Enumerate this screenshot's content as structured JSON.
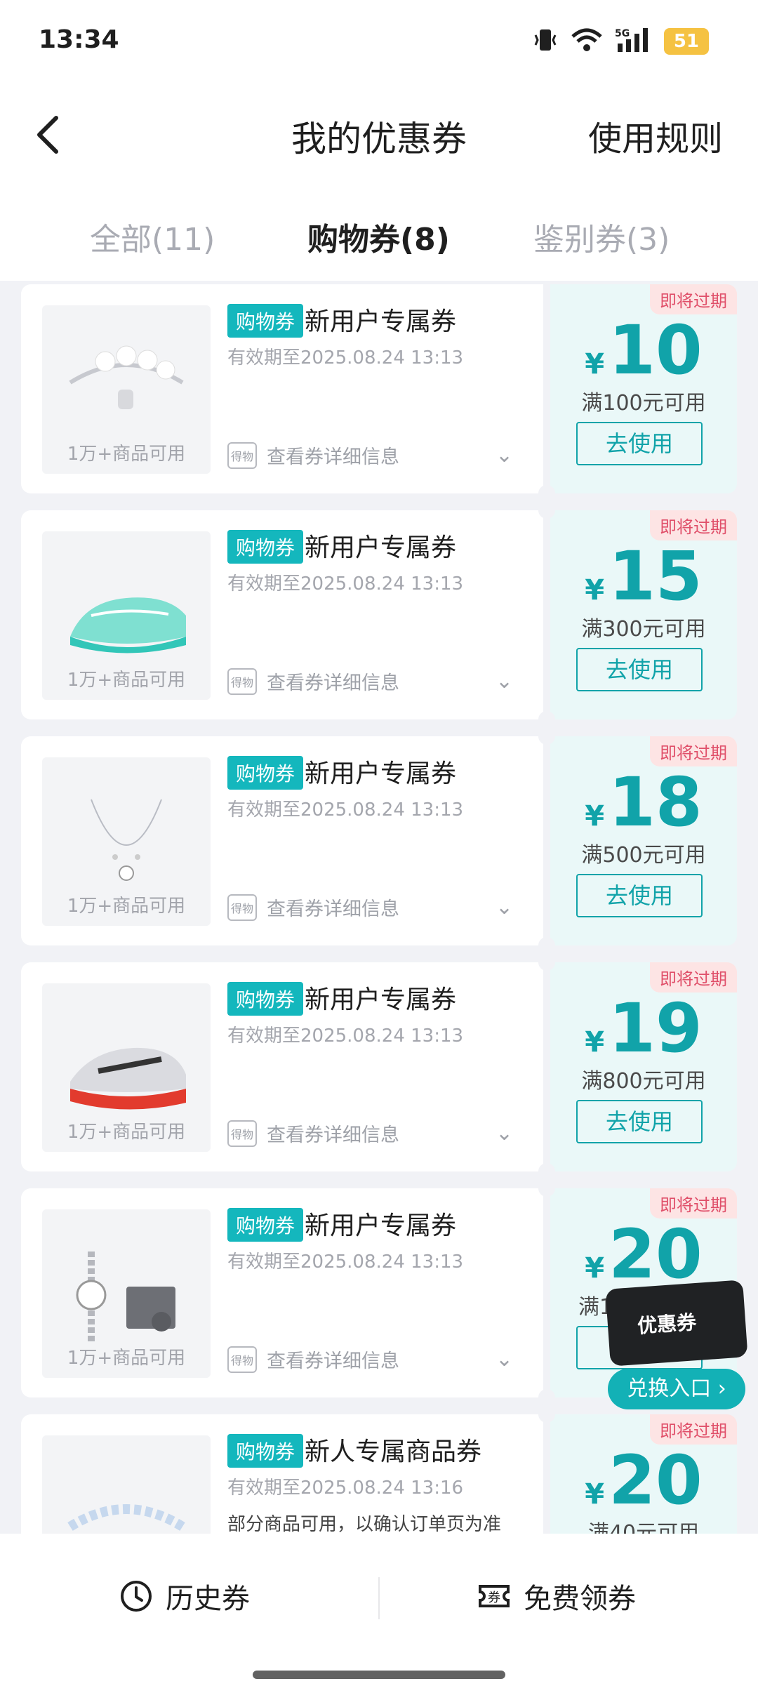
{
  "status": {
    "time": "13:34",
    "battery": "51",
    "network": "5G"
  },
  "header": {
    "title": "我的优惠券",
    "rules_label": "使用规则"
  },
  "tabs": [
    {
      "label": "全部(11)"
    },
    {
      "label": "购物券(8)"
    },
    {
      "label": "鉴别券(3)"
    }
  ],
  "coupons": [
    {
      "badge": "购物券",
      "title": "新用户专属券",
      "validity": "有效期至2025.08.24 13:13",
      "note": "",
      "availability": "1万+商品可用",
      "detail_label": "查看券详细信息",
      "expire_tag": "即将过期",
      "currency": "¥",
      "amount": "10",
      "condition": "满100元可用",
      "button": "去使用"
    },
    {
      "badge": "购物券",
      "title": "新用户专属券",
      "validity": "有效期至2025.08.24 13:13",
      "note": "",
      "availability": "1万+商品可用",
      "detail_label": "查看券详细信息",
      "expire_tag": "即将过期",
      "currency": "¥",
      "amount": "15",
      "condition": "满300元可用",
      "button": "去使用"
    },
    {
      "badge": "购物券",
      "title": "新用户专属券",
      "validity": "有效期至2025.08.24 13:13",
      "note": "",
      "availability": "1万+商品可用",
      "detail_label": "查看券详细信息",
      "expire_tag": "即将过期",
      "currency": "¥",
      "amount": "18",
      "condition": "满500元可用",
      "button": "去使用"
    },
    {
      "badge": "购物券",
      "title": "新用户专属券",
      "validity": "有效期至2025.08.24 13:13",
      "note": "",
      "availability": "1万+商品可用",
      "detail_label": "查看券详细信息",
      "expire_tag": "即将过期",
      "currency": "¥",
      "amount": "19",
      "condition": "满800元可用",
      "button": "去使用"
    },
    {
      "badge": "购物券",
      "title": "新用户专属券",
      "validity": "有效期至2025.08.24 13:13",
      "note": "",
      "availability": "1万+商品可用",
      "detail_label": "查看券详细信息",
      "expire_tag": "即将过期",
      "currency": "¥",
      "amount": "20",
      "condition": "满1",
      "button": "去"
    },
    {
      "badge": "购物券",
      "title": "新人专属商品券",
      "validity": "有效期至2025.08.24 13:16",
      "note": "部分商品可用，以确认订单页为准",
      "availability": "",
      "detail_label": "",
      "expire_tag": "即将过期",
      "currency": "¥",
      "amount": "20",
      "condition": "满40元可用",
      "button": ""
    }
  ],
  "float_entry": {
    "card_label": "优惠券",
    "button": "兑换入口 ›"
  },
  "bottom": {
    "history_label": "历史券",
    "free_label": "免费领券"
  },
  "colors": {
    "accent": "#11a3a9",
    "badge": "#14b7bd",
    "expire": "#e0506a"
  }
}
